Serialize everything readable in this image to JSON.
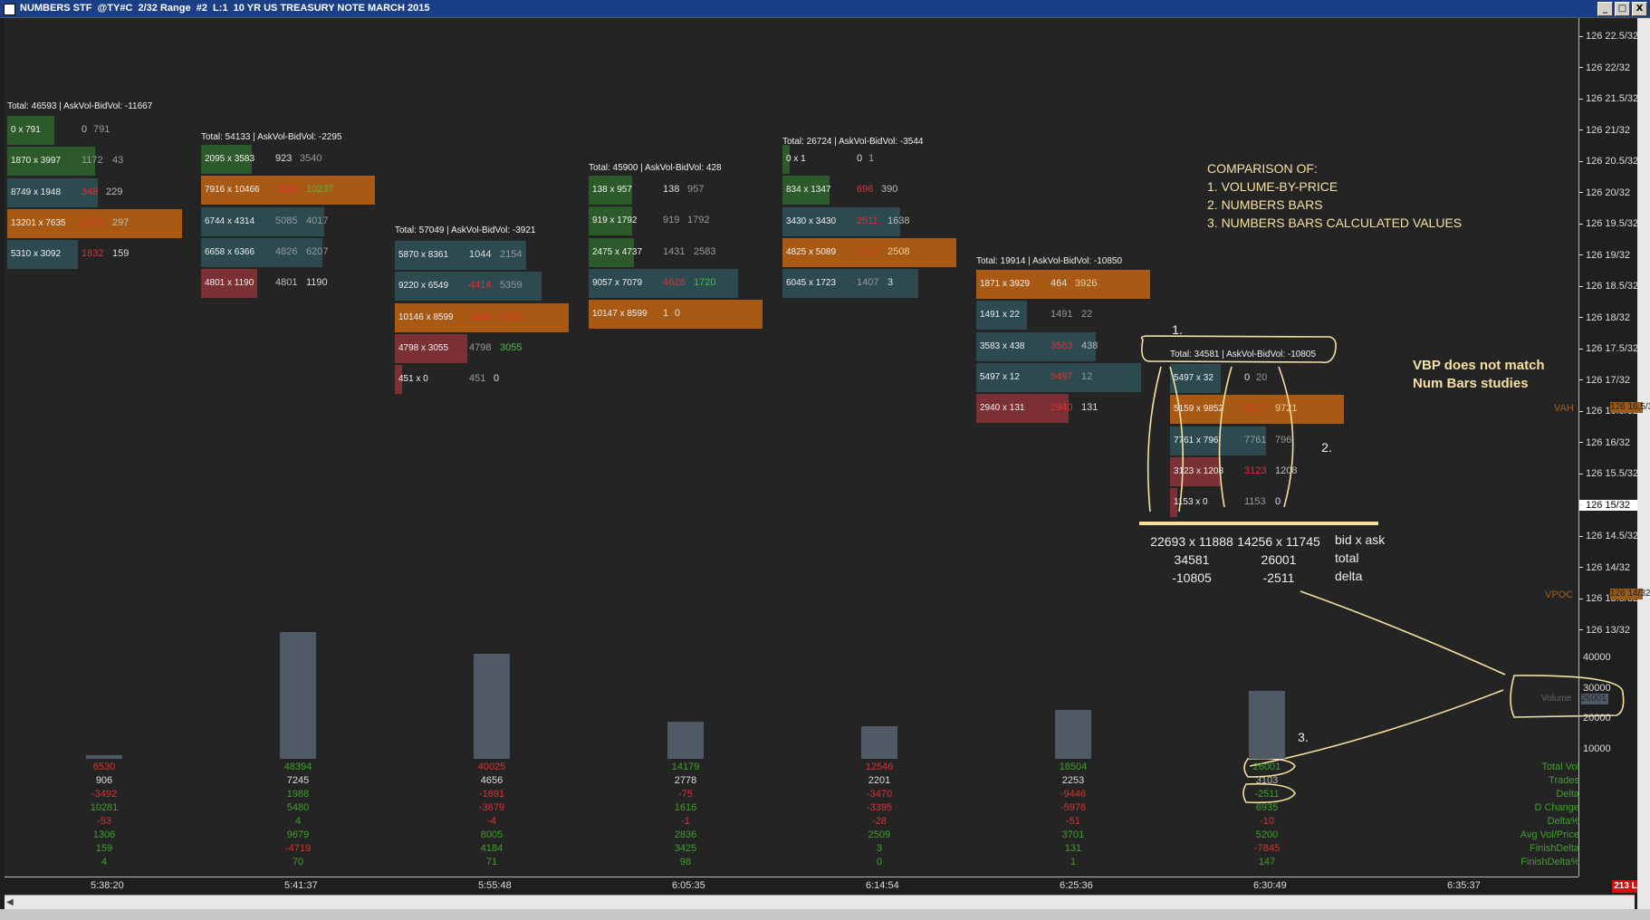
{
  "window": {
    "title": "NUMBERS STF  @TY#C  2/32 Range  #2  L:1  10 YR US TREASURY NOTE MARCH 2015",
    "btn_min": "_",
    "btn_max": "□",
    "btn_close": "X"
  },
  "price_axis": {
    "ticks": [
      "126 22.5/32",
      "126 22/32",
      "126 21.5/32",
      "126 21/32",
      "126 20.5/32",
      "126 20/32",
      "126 19.5/32",
      "126 19/32",
      "126 18.5/32",
      "126 18/32",
      "126 17.5/32",
      "126 17/32",
      "126 16.5/32",
      "126 16/32",
      "126 15.5/32",
      "126 15/32",
      "126 14.5/32",
      "126 14/32",
      "126 13.5/32",
      "126 13/32"
    ],
    "current": "126 15/32",
    "vah_label": "VAH",
    "vah_value": "126 16.5/32",
    "vpoc_label": "VPOC",
    "vpoc_value": "126 14/32",
    "volume_ticks": [
      "40000",
      "30000",
      "20000",
      "10000"
    ],
    "volume_label": "Volume",
    "volume_value": "26001"
  },
  "bars": [
    {
      "title": "Total: 46593 | AskVol-BidVol: -11667",
      "rows": [
        {
          "ba": "0 x 791",
          "v1": "0",
          "v2": "791",
          "c": "green",
          "c1": "#bbb",
          "c2": "#999"
        },
        {
          "ba": "1870 x 3997",
          "v1": "1172",
          "v2": "43",
          "c": "green",
          "c1": "#999",
          "c2": "#999"
        },
        {
          "ba": "8749 x 1948",
          "v1": "348",
          "v2": "229",
          "c": "teal",
          "c1": "#e03030",
          "c2": "#bbb"
        },
        {
          "ba": "13201 x 7635",
          "v1": "1659",
          "v2": "297",
          "c": "orange",
          "c1": "#e03030",
          "c2": "#bbb"
        },
        {
          "ba": "5310 x 3092",
          "v1": "1832",
          "v2": "159",
          "c": "teal",
          "c1": "#e03030",
          "c2": "#ddd"
        }
      ]
    },
    {
      "title": "Total: 54133 | AskVol-BidVol: -2295",
      "rows": [
        {
          "ba": "2095 x 3583",
          "v1": "923",
          "v2": "3540",
          "c": "green",
          "c1": "#ddd",
          "c2": "#999"
        },
        {
          "ba": "7916 x 10466",
          "v1": "1126",
          "v2": "10237",
          "c": "orange",
          "c1": "#e03030",
          "c2": "#40c040"
        },
        {
          "ba": "6744 x 4314",
          "v1": "5085",
          "v2": "4017",
          "c": "teal",
          "c1": "#999",
          "c2": "#999"
        },
        {
          "ba": "6658 x 6366",
          "v1": "4826",
          "v2": "6207",
          "c": "teal",
          "c1": "#999",
          "c2": "#999"
        },
        {
          "ba": "4801 x 1190",
          "v1": "4801",
          "v2": "1190",
          "c": "red",
          "c1": "#bbb",
          "c2": "#ddd"
        }
      ]
    },
    {
      "title": "Total: 57049 | AskVol-BidVol: -3921",
      "rows": [
        {
          "ba": "5870 x 8361",
          "v1": "1044",
          "v2": "2154",
          "c": "teal",
          "c1": "#ddd",
          "c2": "#999"
        },
        {
          "ba": "9220 x 6549",
          "v1": "4414",
          "v2": "5359",
          "c": "teal",
          "c1": "#e03030",
          "c2": "#999"
        },
        {
          "ba": "10146 x 8599",
          "v1": "1134",
          "v2": "8599",
          "c": "orange",
          "c1": "#e03030",
          "c2": "#e03030"
        },
        {
          "ba": "4798 x 3055",
          "v1": "4798",
          "v2": "3055",
          "c": "red",
          "c1": "#999",
          "c2": "#40c040"
        },
        {
          "ba": "451 x 0",
          "v1": "451",
          "v2": "0",
          "c": "red",
          "c1": "#999",
          "c2": "#ddd"
        }
      ]
    },
    {
      "title": "Total: 45900 | AskVol-BidVol: 428",
      "rows": [
        {
          "ba": "138 x 957",
          "v1": "138",
          "v2": "957",
          "c": "green",
          "c1": "#ddd",
          "c2": "#999"
        },
        {
          "ba": "919 x 1792",
          "v1": "919",
          "v2": "1792",
          "c": "green",
          "c1": "#999",
          "c2": "#999"
        },
        {
          "ba": "2475 x 4737",
          "v1": "1431",
          "v2": "2583",
          "c": "green",
          "c1": "#999",
          "c2": "#999"
        },
        {
          "ba": "9057 x 7079",
          "v1": "4628",
          "v2": "1720",
          "c": "teal",
          "c1": "#e03030",
          "c2": "#40c040"
        },
        {
          "ba": "10147 x 8599",
          "v1": "1",
          "v2": "0",
          "c": "orange",
          "c1": "#ddd",
          "c2": "#ddd"
        }
      ]
    },
    {
      "title": "Total: 26724 | AskVol-BidVol: -3544",
      "rows": [
        {
          "ba": "0 x 1",
          "v1": "0",
          "v2": "1",
          "c": "green",
          "c1": "#ddd",
          "c2": "#999"
        },
        {
          "ba": "834 x 1347",
          "v1": "696",
          "v2": "390",
          "c": "green",
          "c1": "#e03030",
          "c2": "#bbb"
        },
        {
          "ba": "3430 x 3430",
          "v1": "2511",
          "v2": "1638",
          "c": "teal",
          "c1": "#e03030",
          "c2": "#bbb"
        },
        {
          "ba": "4825 x 5089",
          "v1": "1317",
          "v2": "2508",
          "c": "orange",
          "c1": "#e03030",
          "c2": "#e8d0a0"
        },
        {
          "ba": "6045 x 1723",
          "v1": "1407",
          "v2": "3",
          "c": "teal",
          "c1": "#999",
          "c2": "#ddd"
        }
      ]
    },
    {
      "title": "Total: 19914 | AskVol-BidVol: -10850",
      "rows": [
        {
          "ba": "1871 x 3929",
          "v1": "464",
          "v2": "3926",
          "c": "orange",
          "c1": "#ddd",
          "c2": "#e8d0a0"
        },
        {
          "ba": "1491 x 22",
          "v1": "1491",
          "v2": "22",
          "c": "teal",
          "c1": "#999",
          "c2": "#999"
        },
        {
          "ba": "3583 x 438",
          "v1": "3583",
          "v2": "438",
          "c": "teal",
          "c1": "#e03030",
          "c2": "#bbb"
        },
        {
          "ba": "5497 x 12",
          "v1": "5497",
          "v2": "12",
          "c": "teal",
          "c1": "#e03030",
          "c2": "#999"
        },
        {
          "ba": "2940 x 131",
          "v1": "2940",
          "v2": "131",
          "c": "red",
          "c1": "#e03030",
          "c2": "#ddd"
        }
      ]
    },
    {
      "title": "Total: 34581 | AskVol-BidVol: -10805",
      "rows": [
        {
          "ba": "5497 x 32",
          "v1": "0",
          "v2": "20",
          "c": "teal",
          "c1": "#ddd",
          "c2": "#999"
        },
        {
          "ba": "5159 x 9852",
          "v1": "3219",
          "v2": "9721",
          "c": "orange",
          "c1": "#e03030",
          "c2": "#e8d0a0"
        },
        {
          "ba": "7761 x 796",
          "v1": "7761",
          "v2": "796",
          "c": "teal",
          "c1": "#999",
          "c2": "#999"
        },
        {
          "ba": "3123 x 1208",
          "v1": "3123",
          "v2": "1208",
          "c": "red",
          "c1": "#e03030",
          "c2": "#bbb"
        },
        {
          "ba": "1153 x 0",
          "v1": "1153",
          "v2": "0",
          "c": "red",
          "c1": "#999",
          "c2": "#ddd"
        }
      ]
    }
  ],
  "volume_bars": [
    {
      "volume": 1500
    },
    {
      "volume": 48394
    },
    {
      "volume": 40025
    },
    {
      "volume": 14179
    },
    {
      "volume": 12546
    },
    {
      "volume": 18504
    },
    {
      "volume": 26001
    }
  ],
  "stats": {
    "labels": [
      "Total Vol",
      "Trades",
      "Delta",
      "D Change",
      "Delta%",
      "Avg Vol/Price",
      "FinishDelta",
      "FinishDelta%"
    ],
    "columns": [
      [
        "6530",
        "906",
        "-3492",
        "10281",
        "-53",
        "1306",
        "159",
        "4"
      ],
      [
        "48394",
        "7245",
        "1988",
        "5480",
        "4",
        "9679",
        "-4719",
        "70"
      ],
      [
        "40025",
        "4656",
        "-1691",
        "-3679",
        "-4",
        "8005",
        "4184",
        "71"
      ],
      [
        "14179",
        "2778",
        "-75",
        "1616",
        "-1",
        "2836",
        "3425",
        "98"
      ],
      [
        "12546",
        "2201",
        "-3470",
        "-3395",
        "-28",
        "2509",
        "3",
        "0"
      ],
      [
        "18504",
        "2253",
        "-9446",
        "-5976",
        "-51",
        "3701",
        "131",
        "1"
      ],
      [
        "26001",
        "3103",
        "-2511",
        "6935",
        "-10",
        "5200",
        "-7845",
        "147"
      ]
    ]
  },
  "times": [
    "5:38:20",
    "5:41:37",
    "5:55:48",
    "6:05:35",
    "6:14:54",
    "6:25:36",
    "6:30:49",
    "6:35:37"
  ],
  "status_badge": "213 L",
  "notes": {
    "comparison": [
      "COMPARISON OF:",
      "1. VOLUME-BY-PRICE",
      "2. NUMBERS BARS",
      "3. NUMBERS BARS CALCULATED VALUES"
    ],
    "mismatch": [
      "VBP does not match",
      "Num Bars studies"
    ],
    "marker1": "1.",
    "marker2": "2.",
    "marker3": "3.",
    "vbp_col": [
      "22693 x 11888",
      "34581",
      "-10805"
    ],
    "num_col": [
      "14256 x 11745",
      "26001",
      "-2511"
    ],
    "legend": [
      "bid x ask",
      "total",
      "delta"
    ]
  },
  "colors": {
    "positive": "#40c040",
    "negative": "#e03030",
    "volume_bar": "#4f5a66",
    "annotation": "#f5e0a0"
  }
}
